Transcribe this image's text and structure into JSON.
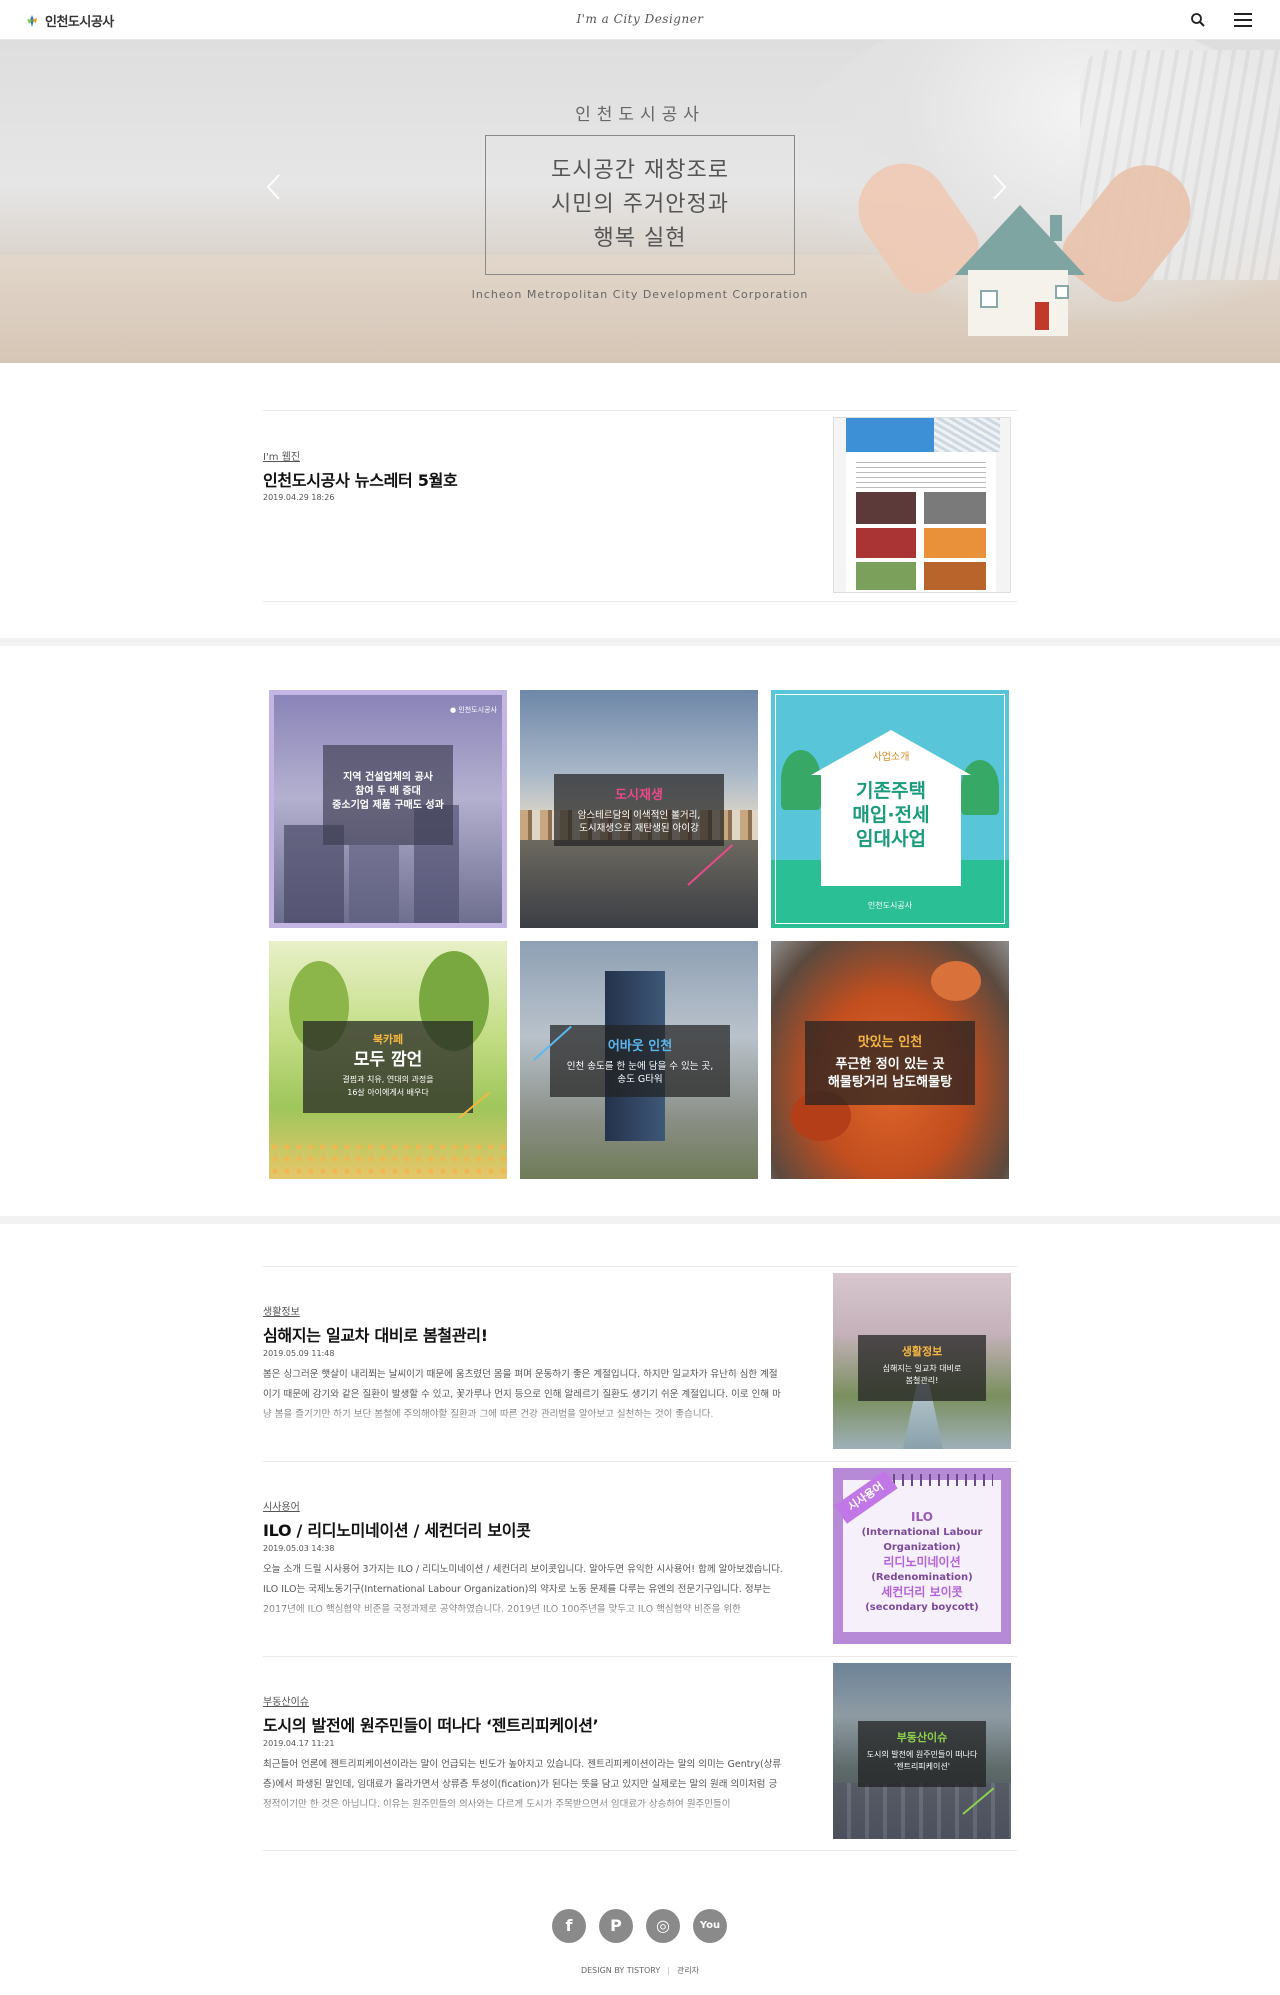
{
  "header": {
    "logo_text": "인천도시공사",
    "tagline": "I'm a City Designer",
    "icons": [
      "logo-icon",
      "search-icon",
      "menu-icon"
    ]
  },
  "hero": {
    "org": "인천도시공사",
    "slogan_lines": [
      "도시공간 재창조로",
      "시민의 주거안정과",
      "행복 실현"
    ],
    "english": "Incheon Metropolitan City Development Corporation",
    "icons": [
      "chevron-left-icon",
      "chevron-right-icon"
    ]
  },
  "featured": {
    "category": "I'm 웹진",
    "title": "인천도시공사 뉴스레터 5월호",
    "date": "2019.04.29 18:26"
  },
  "grid": [
    {
      "cat": "",
      "title": "지역 건설업체의 공사\n참여 두 배 증대\n중소기업 제품 구매도 성과",
      "sub": ""
    },
    {
      "cat": "도시재생",
      "title": "",
      "sub": "암스테르담의 이색적인 볼거리,\n도시재생으로 재탄생된 아이강"
    },
    {
      "cat": "사업소개",
      "title": "기존주택\n매입·전세\n임대사업",
      "sub": "인천도시공사"
    },
    {
      "cat": "북카페",
      "title": "모두 깜언",
      "sub": "결핍과 치유, 연대의 과정을\n16살 아이에게서 배우다"
    },
    {
      "cat": "어바웃 인천",
      "title": "",
      "sub": "인천 송도를 한 눈에 담을 수 있는 곳,\n송도 G타워"
    },
    {
      "cat": "맛있는 인천",
      "title": "푸근한 정이 있는 곳\n해물탕거리 남도해물탕",
      "sub": ""
    }
  ],
  "posts": [
    {
      "category": "생활정보",
      "title": "심해지는 일교차 대비로 봄철관리!",
      "date": "2019.05.09 11:48",
      "excerpt": "봄은 싱그러운 햇살이 내리쬐는 날씨이기 때문에 움츠렸던 몸을 펴며 운동하기 좋은 계절입니다. 하지만 일교차가 유난히 심한 계절이기 때문에 감기와 같은 질환이 발생할 수 있고, 꽃가루나 먼지 등으로 인해 알레르기 질환도 생기기 쉬운 계절입니다. 이로 인해 마냥 봄을 즐기기만 하기 보단 봄철에 주의해야할 질환과 그에 따른 건강 관리법을 알아보고 실천하는 것이 좋습니다.",
      "thumb_cat": "생활정보",
      "thumb_text": "심해지는 일교차 대비로\n봄철관리!"
    },
    {
      "category": "시사용어",
      "title": "ILO / 리디노미네이션 / 세컨더리 보이콧",
      "date": "2019.05.03 14:38",
      "excerpt": "오늘 소개 드릴 시사용어 3가지는 ILO / 리디노미네이션 / 세컨더리 보이콧입니다. 알아두면 유익한 시사용어! 함께 알아보겠습니다. ILO ILO는 국제노동기구(International Labour Organization)의 약자로 노동 문제를 다루는 유엔의 전문기구입니다. 정부는 2017년에 ILO 핵심협약 비준을 국정과제로 공약하였습니다. 2019년 ILO 100주년을 맞두고 ILO 핵심협약 비준을 위한",
      "thumb_cat": "시사용어",
      "thumb_text": ""
    },
    {
      "category": "부동산이슈",
      "title": "도시의 발전에 원주민들이 떠나다 ‘젠트리피케이션’",
      "date": "2019.04.17 11:21",
      "excerpt": "최근들어 언론에 젠트리피케이션이라는 말이 언급되는 빈도가 높아지고 있습니다. 젠트리피케이션이라는 말의 의미는 Gentry(상류층)에서 파생된 말인데, 임대료가 올라가면서 상류층 투성이(fication)가 된다는 뜻을 담고 있지만 실제로는 말의 원래 의미처럼 긍정적이기만 한 것은 아닙니다. 이유는 원주민들의 의사와는 다르게 도시가 주목받으면서 임대료가 상승하여 원주민들이",
      "thumb_cat": "부동산이슈",
      "thumb_text": "도시의 발전에 원주민들이 떠나다\n'젠트리피케이션'"
    }
  ],
  "ilo_card": {
    "badge": "시사용어",
    "lines": [
      {
        "text": "ILO",
        "color": "#9b59b6"
      },
      {
        "text": "(International Labour",
        "color": "#7d4a9a"
      },
      {
        "text": "Organization)",
        "color": "#7d4a9a"
      },
      {
        "text": "리디노미네이션",
        "color": "#b561d8"
      },
      {
        "text": "(Redenomination)",
        "color": "#7d4a9a"
      },
      {
        "text": "세컨더리 보이콧",
        "color": "#b561d8"
      },
      {
        "text": "(secondary boycott)",
        "color": "#7d4a9a"
      }
    ]
  },
  "footer": {
    "social": [
      {
        "name": "facebook-icon",
        "glyph": "f"
      },
      {
        "name": "post-icon",
        "glyph": "P"
      },
      {
        "name": "instagram-icon",
        "glyph": "◎"
      },
      {
        "name": "youtube-icon",
        "glyph": "You"
      }
    ],
    "design_by": "DESIGN BY TISTORY",
    "admin": "관리자"
  },
  "colors": {
    "accent_orange": "#f5b642",
    "accent_pink": "#e84a8a",
    "accent_green": "#8fd14f",
    "accent_teal": "#2bbf95"
  }
}
